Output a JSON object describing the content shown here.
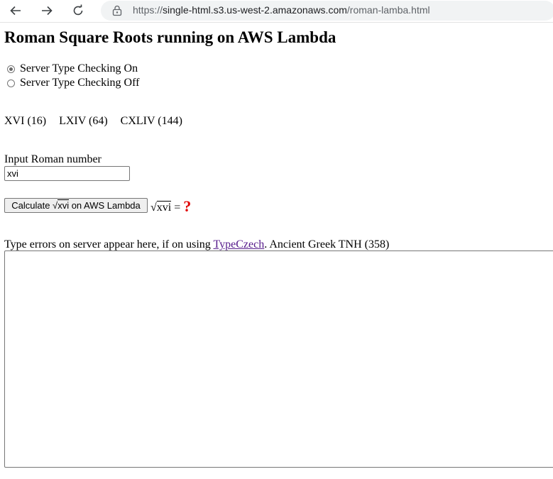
{
  "browser": {
    "url_scheme": "https://",
    "url_host": "single-html.s3.us-west-2.amazonaws.com",
    "url_path": "/roman-lamba.html"
  },
  "page": {
    "title": "Roman Square Roots running on AWS Lambda",
    "radio_on_label": "Server Type Checking On",
    "radio_off_label": "Server Type Checking Off",
    "radio_selected": "on",
    "examples": [
      "XVI (16)",
      "LXIV (64)",
      "CXLIV (144)"
    ],
    "input_label": "Input Roman number",
    "input_value": "xvi",
    "calc_prefix": "Calculate √",
    "calc_arg": "xvi",
    "calc_suffix": " on AWS Lambda",
    "result_sqrt": "√",
    "result_arg": "xvi",
    "result_eq": " =",
    "result_value": "?",
    "errors_text": "Type errors on server appear here, if on using ",
    "errors_link": "TypeCzech",
    "errors_suffix": ". Ancient Greek TNH (358)",
    "errors_value": ""
  },
  "colors": {
    "result": "#e00000",
    "link_visited": "#551a8b"
  }
}
